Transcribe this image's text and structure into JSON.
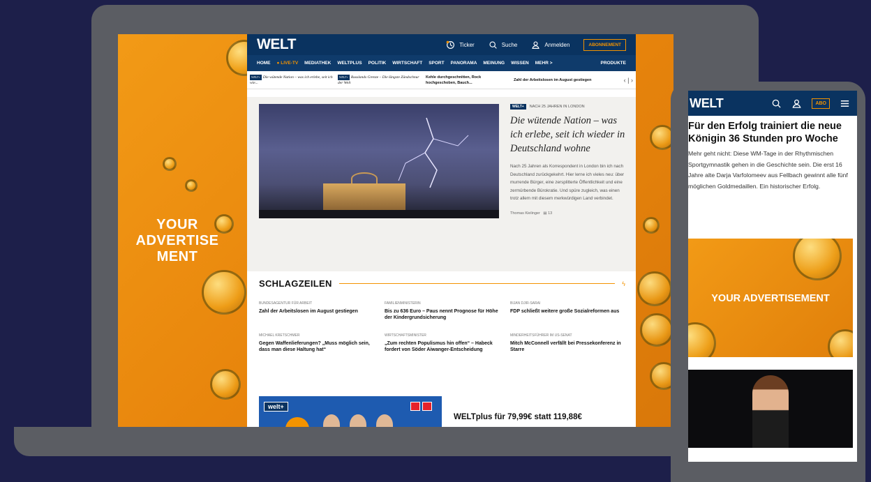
{
  "laptop": {
    "ad_text": "YOUR ADVERTISE MENT",
    "welt": {
      "logo": "WELT",
      "top_links": {
        "ticker": "Ticker",
        "search": "Suche",
        "login": "Anmelden",
        "abo": "ABONNEMENT"
      },
      "nav": [
        "HOME",
        "● LIVE-TV",
        "MEDIATHEK",
        "WELTPLUS",
        "POLITIK",
        "WIRTSCHAFT",
        "SPORT",
        "PANORAMA",
        "MEINUNG",
        "WISSEN",
        "MEHR >"
      ],
      "nav_products": "PRODUKTE",
      "ticker": [
        {
          "badge": "WELT+",
          "text": "Die wütende Nation – was ich erlebe, seit ich wie...",
          "italic": true
        },
        {
          "badge": "WELT+",
          "text": "Russlands Grenze – Die längste Zündschnur der Welt",
          "italic": true
        },
        {
          "badge": "",
          "text": "Kehle durchgeschnitten, Rock hochgeschoben, Bauch...",
          "italic": false
        },
        {
          "badge": "",
          "text": "Zahl der Arbeitslosen im August gestiegen",
          "italic": false
        }
      ],
      "hero": {
        "badge": "WELT+",
        "kicker": "NACH 25 JAHREN IN LONDON",
        "title": "Die wütende Nation – was ich erlebe, seit ich wieder in Deutschland wohne",
        "body": "Nach 25 Jahren als Korrespondent in London bin ich nach Deutschland zurückgekehrt. Hier lerne ich vieles neu: über murrende Bürger, eine zersplitterte Öffentlichkeit und eine zermürbende Bürokratie. Und spüre zugleich, was einen trotz allem mit diesem merkwürdigen Land verbindet.",
        "author": "Thomas Kielinger",
        "comments": "13"
      },
      "schlagzeilen": {
        "title": "SCHLAGZEILEN",
        "items": [
          {
            "cat": "BUNDESAGENTUR FÜR ARBEIT",
            "headline": "Zahl der Arbeitslosen im August gestiegen"
          },
          {
            "cat": "FAMILIENMINISTERIN",
            "headline": "Bis zu 636 Euro – Paus nennt Prognose für Höhe der Kindergrundsicherung"
          },
          {
            "cat": "BIJAN DJIR-SARAI",
            "headline": "FDP schließt weitere große Sozialreformen aus"
          },
          {
            "cat": "MICHAEL KRETSCHMER",
            "headline": "Gegen Waffenlieferungen? „Muss möglich sein, dass man diese Haltung hat“"
          },
          {
            "cat": "WIRTSCHAFTSMINISTER",
            "headline": "„Zum rechten Populismus hin offen“ – Habeck fordert von Söder Aiwanger-Entscheidung"
          },
          {
            "cat": "MINDERHEITSFÜHRER IM US-SENAT",
            "headline": "Mitch McConnell verfällt bei Pressekonferenz in Starre"
          }
        ]
      },
      "promo": {
        "badge": "welt+",
        "text": "WELTplus für 79,99€ statt 119,88€"
      }
    }
  },
  "phone": {
    "logo": "WELT",
    "abo": "ABO",
    "title": "Für den Erfolg trainiert die neue Königin 36 Stunden pro Woche",
    "body": "Mehr geht nicht: Diese WM-Tage in der Rhythmischen Sportgymnastik gehen in die Geschichte sein. Die erst 16 Jahre alte Darja Varfolomeev aus Fellbach gewinnt alle fünf möglichen Goldmedaillen. Ein historischer Erfolg.",
    "ad_text": "YOUR ADVERTISEMENT"
  },
  "colors": {
    "background": "#1d1f4a",
    "welt_navy": "#0a3360",
    "accent_orange": "#f39300",
    "device_gray": "#5b5d63"
  }
}
